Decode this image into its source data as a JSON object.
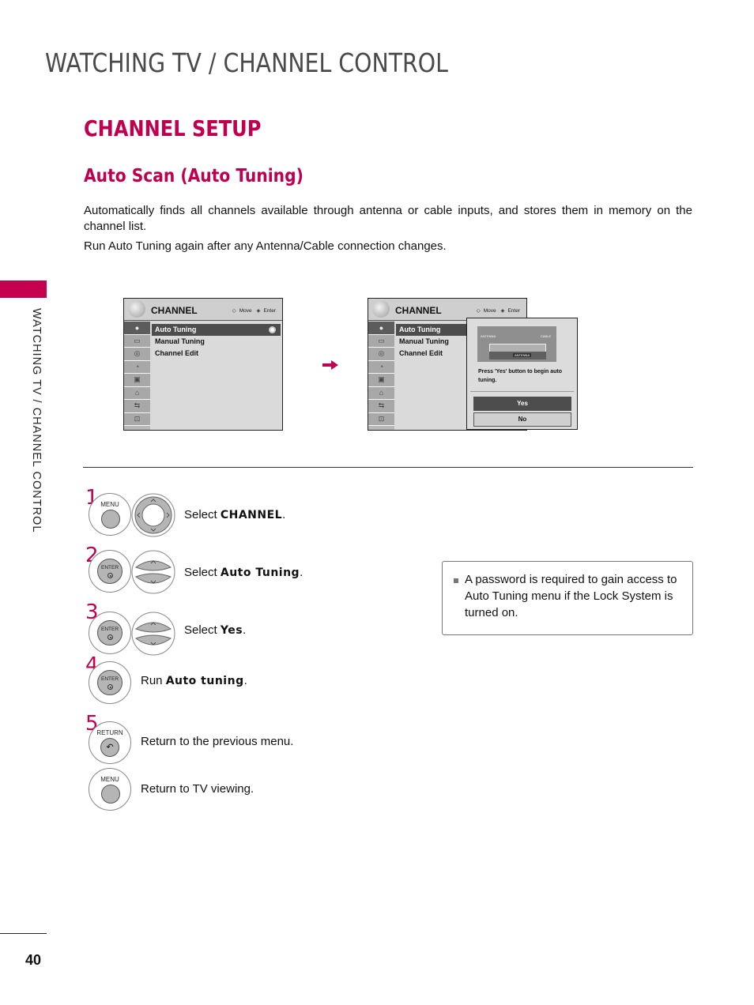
{
  "page": {
    "heading": "WATCHING TV / CHANNEL CONTROL",
    "section_title": "CHANNEL SETUP",
    "subsection_title": "Auto Scan (Auto Tuning)",
    "description_1": "Automatically finds all channels available through antenna or cable inputs, and stores them in memory on the channel list.",
    "description_2": "Run Auto Tuning again after any Antenna/Cable connection changes.",
    "side_label": "WATCHING TV / CHANNEL CONTROL",
    "page_number": "40",
    "accent_color": "#c5004f"
  },
  "osd_left": {
    "title": "CHANNEL",
    "nav_move": "Move",
    "nav_enter": "Enter",
    "icons": [
      "channel-icon",
      "picture-icon",
      "audio-icon",
      "time-icon",
      "option-icon",
      "lock-icon",
      "input-icon",
      "usb-icon"
    ],
    "items": [
      "Auto Tuning",
      "Manual Tuning",
      "Channel Edit"
    ],
    "selected_index": 0
  },
  "osd_right": {
    "title": "CHANNEL",
    "nav_move": "Move",
    "nav_enter": "Enter",
    "items": [
      "Auto Tuning",
      "Manual Tuning",
      "Channel Edit"
    ],
    "selected_index": 0,
    "popup": {
      "diagram_antenna": "ANTENNA",
      "diagram_cable": "CABLE",
      "diagram_input": "ANTENNA",
      "message": "Press 'Yes' button to begin auto tuning.",
      "yes_label": "Yes",
      "no_label": "No"
    }
  },
  "steps": [
    {
      "num": "1",
      "buttons": [
        "MENU",
        "nav-pad"
      ],
      "prefix": "Select ",
      "bold": "CHANNEL",
      "suffix": "."
    },
    {
      "num": "2",
      "buttons": [
        "ENTER",
        "up-down"
      ],
      "prefix": "Select ",
      "bold": "Auto Tuning",
      "suffix": "."
    },
    {
      "num": "3",
      "buttons": [
        "ENTER",
        "up-down"
      ],
      "prefix": "Select ",
      "bold": "Yes",
      "suffix": "."
    },
    {
      "num": "4",
      "buttons": [
        "ENTER"
      ],
      "prefix": "Run ",
      "bold": "Auto tuning",
      "suffix": "."
    },
    {
      "num": "5",
      "buttons": [
        "RETURN"
      ],
      "prefix": "Return to the previous menu.",
      "bold": "",
      "suffix": ""
    },
    {
      "num": "",
      "buttons": [
        "MENU"
      ],
      "prefix": "Return to TV viewing.",
      "bold": "",
      "suffix": ""
    }
  ],
  "button_labels": {
    "menu": "MENU",
    "enter": "ENTER",
    "return": "RETURN"
  },
  "note": {
    "text": "A password is required to gain access to Auto Tuning menu if the Lock System is turned on."
  }
}
